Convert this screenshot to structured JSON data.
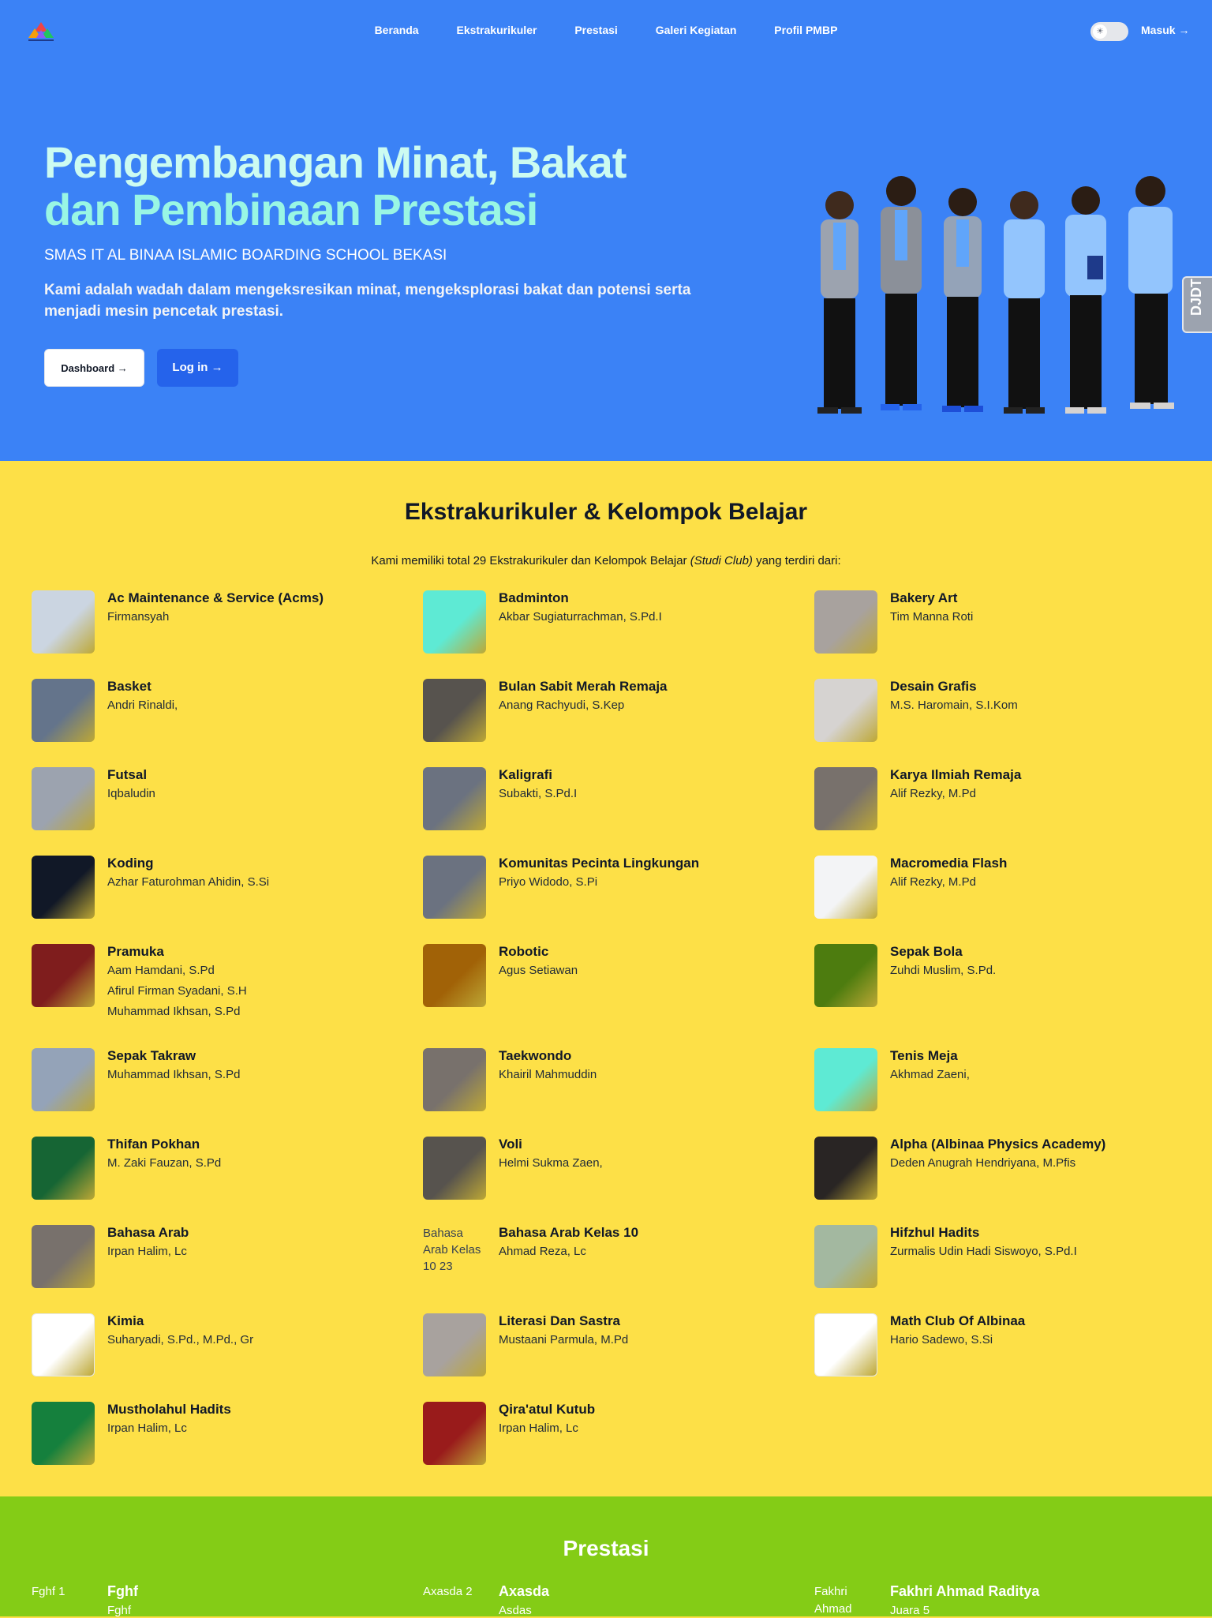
{
  "nav": {
    "links": [
      "Beranda",
      "Ekstrakurikuler",
      "Prestasi",
      "Galeri Kegiatan",
      "Profil PMBP"
    ],
    "login": "Masuk →",
    "toggle_icon": "☀"
  },
  "hero": {
    "title_line1": "Pengembangan Minat, Bakat",
    "title_line2": "dan Pembinaan Prestasi",
    "subtitle": "SMAS IT AL BINAA ISLAMIC BOARDING SCHOOL BEKASI",
    "description": "Kami adalah wadah dalam mengeksresikan minat, mengeksplorasi bakat dan potensi serta menjadi mesin pencetak prestasi.",
    "btn_dashboard": "Dashboard →",
    "btn_login": "Log in →",
    "side_tab": "DJDT"
  },
  "extra": {
    "title": "Ekstrakurikuler & Kelompok Belajar",
    "lead_prefix": "Kami memiliki total 29 Ekstrakurikuler dan Kelompok Belajar ",
    "lead_em": "(Studi Club)",
    "lead_suffix": " yang terdiri dari:",
    "items": [
      {
        "name": "Ac Maintenance & Service (Acms)",
        "coaches": [
          "Firmansyah"
        ],
        "color": "#cbd5e1"
      },
      {
        "name": "Badminton",
        "coaches": [
          "Akbar Sugiaturrachman, S.Pd.I"
        ],
        "color": "#5eead4"
      },
      {
        "name": "Bakery Art",
        "coaches": [
          "Tim Manna Roti"
        ],
        "color": "#a8a29e"
      },
      {
        "name": "Basket",
        "coaches": [
          "Andri Rinaldi,"
        ],
        "color": "#64748b"
      },
      {
        "name": "Bulan Sabit Merah Remaja",
        "coaches": [
          "Anang Rachyudi, S.Kep"
        ],
        "color": "#57534e"
      },
      {
        "name": "Desain Grafis",
        "coaches": [
          "M.S. Haromain, S.I.Kom"
        ],
        "color": "#d6d3d1"
      },
      {
        "name": "Futsal",
        "coaches": [
          "Iqbaludin"
        ],
        "color": "#9ca3af"
      },
      {
        "name": "Kaligrafi",
        "coaches": [
          "Subakti, S.Pd.I"
        ],
        "color": "#6b7280"
      },
      {
        "name": "Karya Ilmiah Remaja",
        "coaches": [
          "Alif Rezky, M.Pd"
        ],
        "color": "#78716c"
      },
      {
        "name": "Koding",
        "coaches": [
          "Azhar Faturohman Ahidin, S.Si"
        ],
        "color": "#111827"
      },
      {
        "name": "Komunitas Pecinta Lingkungan",
        "coaches": [
          "Priyo Widodo, S.Pi"
        ],
        "color": "#6b7280"
      },
      {
        "name": "Macromedia Flash",
        "coaches": [
          "Alif Rezky, M.Pd"
        ],
        "color": "#f3f4f6"
      },
      {
        "name": "Pramuka",
        "coaches": [
          "Aam Hamdani, S.Pd",
          "Afirul Firman Syadani, S.H",
          "Muhammad Ikhsan, S.Pd"
        ],
        "color": "#7f1d1d"
      },
      {
        "name": "Robotic",
        "coaches": [
          "Agus Setiawan"
        ],
        "color": "#a16207"
      },
      {
        "name": "Sepak Bola",
        "coaches": [
          "Zuhdi Muslim, S.Pd."
        ],
        "color": "#4d7c0f"
      },
      {
        "name": "Sepak Takraw",
        "coaches": [
          "Muhammad Ikhsan, S.Pd"
        ],
        "color": "#94a3b8"
      },
      {
        "name": "Taekwondo",
        "coaches": [
          "Khairil Mahmuddin"
        ],
        "color": "#78716c"
      },
      {
        "name": "Tenis Meja",
        "coaches": [
          "Akhmad Zaeni,"
        ],
        "color": "#5eead4"
      },
      {
        "name": "Thifan Pokhan",
        "coaches": [
          "M. Zaki Fauzan, S.Pd"
        ],
        "color": "#166534"
      },
      {
        "name": "Voli",
        "coaches": [
          "Helmi Sukma Zaen,"
        ],
        "color": "#57534e"
      },
      {
        "name": "Alpha (Albinaa Physics Academy)",
        "coaches": [
          "Deden Anugrah Hendriyana, M.Pfis"
        ],
        "color": "#292524"
      },
      {
        "name": "Bahasa Arab",
        "coaches": [
          "Irpan Halim, Lc"
        ],
        "color": "#78716c"
      },
      {
        "name": "Bahasa Arab Kelas 10",
        "coaches": [
          "Ahmad Reza, Lc"
        ],
        "color": "",
        "alt": "Bahasa Arab Kelas 10 23"
      },
      {
        "name": "Hifzhul Hadits",
        "coaches": [
          "Zurmalis Udin Hadi Siswoyo, S.Pd.I"
        ],
        "color": "#a3b8a0"
      },
      {
        "name": "Kimia",
        "coaches": [
          "Suharyadi, S.Pd., M.Pd., Gr"
        ],
        "color": "#ffffff"
      },
      {
        "name": "Literasi Dan Sastra",
        "coaches": [
          "Mustaani Parmula, M.Pd"
        ],
        "color": "#a8a29e"
      },
      {
        "name": "Math Club Of Albinaa",
        "coaches": [
          "Hario Sadewo, S.Si"
        ],
        "color": "#ffffff"
      },
      {
        "name": "Mustholahul Hadits",
        "coaches": [
          "Irpan Halim, Lc"
        ],
        "color": "#15803d"
      },
      {
        "name": "Qira'atul Kutub",
        "coaches": [
          "Irpan Halim, Lc"
        ],
        "color": "#991b1b"
      }
    ]
  },
  "prestasi": {
    "title": "Prestasi",
    "items": [
      {
        "alt": "Fghf 1",
        "name": "Fghf",
        "sub": "Fghf"
      },
      {
        "alt": "Axasda 2",
        "name": "Axasda",
        "sub": "Asdas"
      },
      {
        "alt": "Fakhri Ahmad",
        "name": "Fakhri Ahmad Raditya",
        "sub": "Juara 5"
      }
    ]
  }
}
